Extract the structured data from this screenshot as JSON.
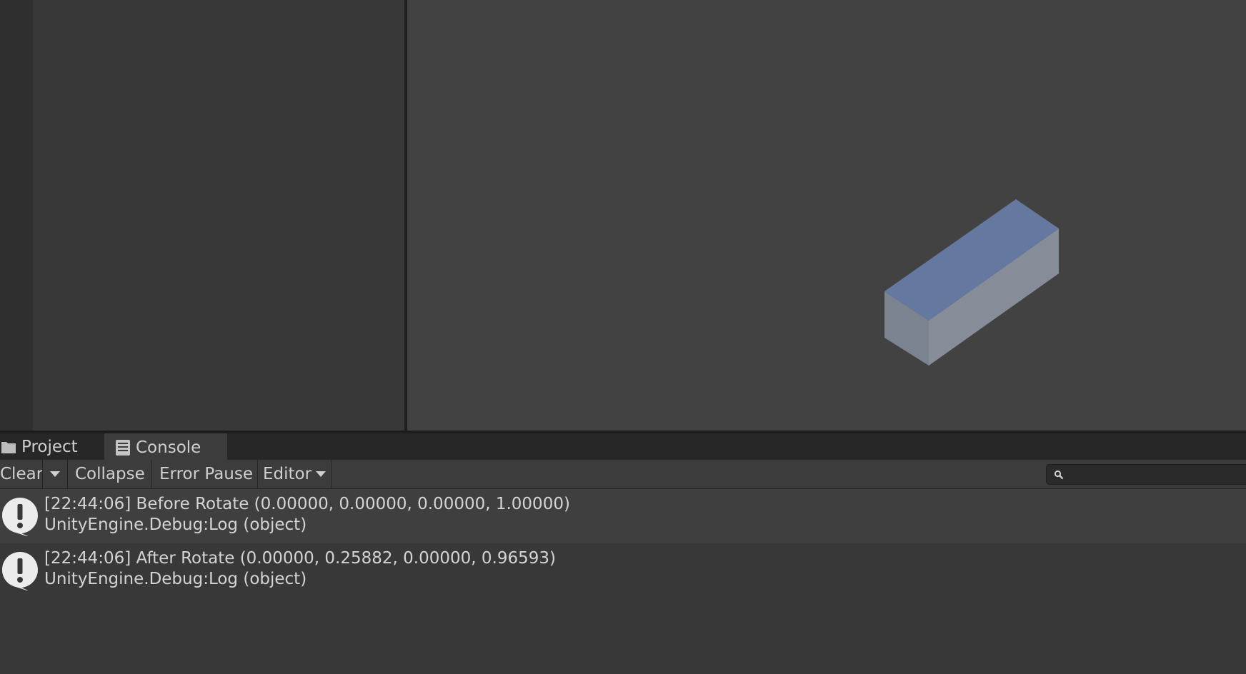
{
  "tabs": [
    {
      "label": "Project",
      "icon": "folder-icon"
    },
    {
      "label": "Console",
      "icon": "console-icon"
    }
  ],
  "toolbar": {
    "clear_label": "Clear",
    "collapse_label": "Collapse",
    "error_pause_label": "Error Pause",
    "editor_label": "Editor",
    "search_placeholder": ""
  },
  "logs": [
    {
      "icon": "info-icon",
      "message": "[22:44:06] Before Rotate (0.00000, 0.00000, 0.00000, 1.00000)",
      "stack": "UnityEngine.Debug:Log (object)"
    },
    {
      "icon": "info-icon",
      "message": "[22:44:06] After Rotate (0.00000, 0.25882, 0.00000, 0.96593)",
      "stack": "UnityEngine.Debug:Log (object)"
    }
  ],
  "colors": {
    "cube_top": "#6578a0",
    "cube_front": "#7b8290",
    "cube_side": "#868c98"
  }
}
